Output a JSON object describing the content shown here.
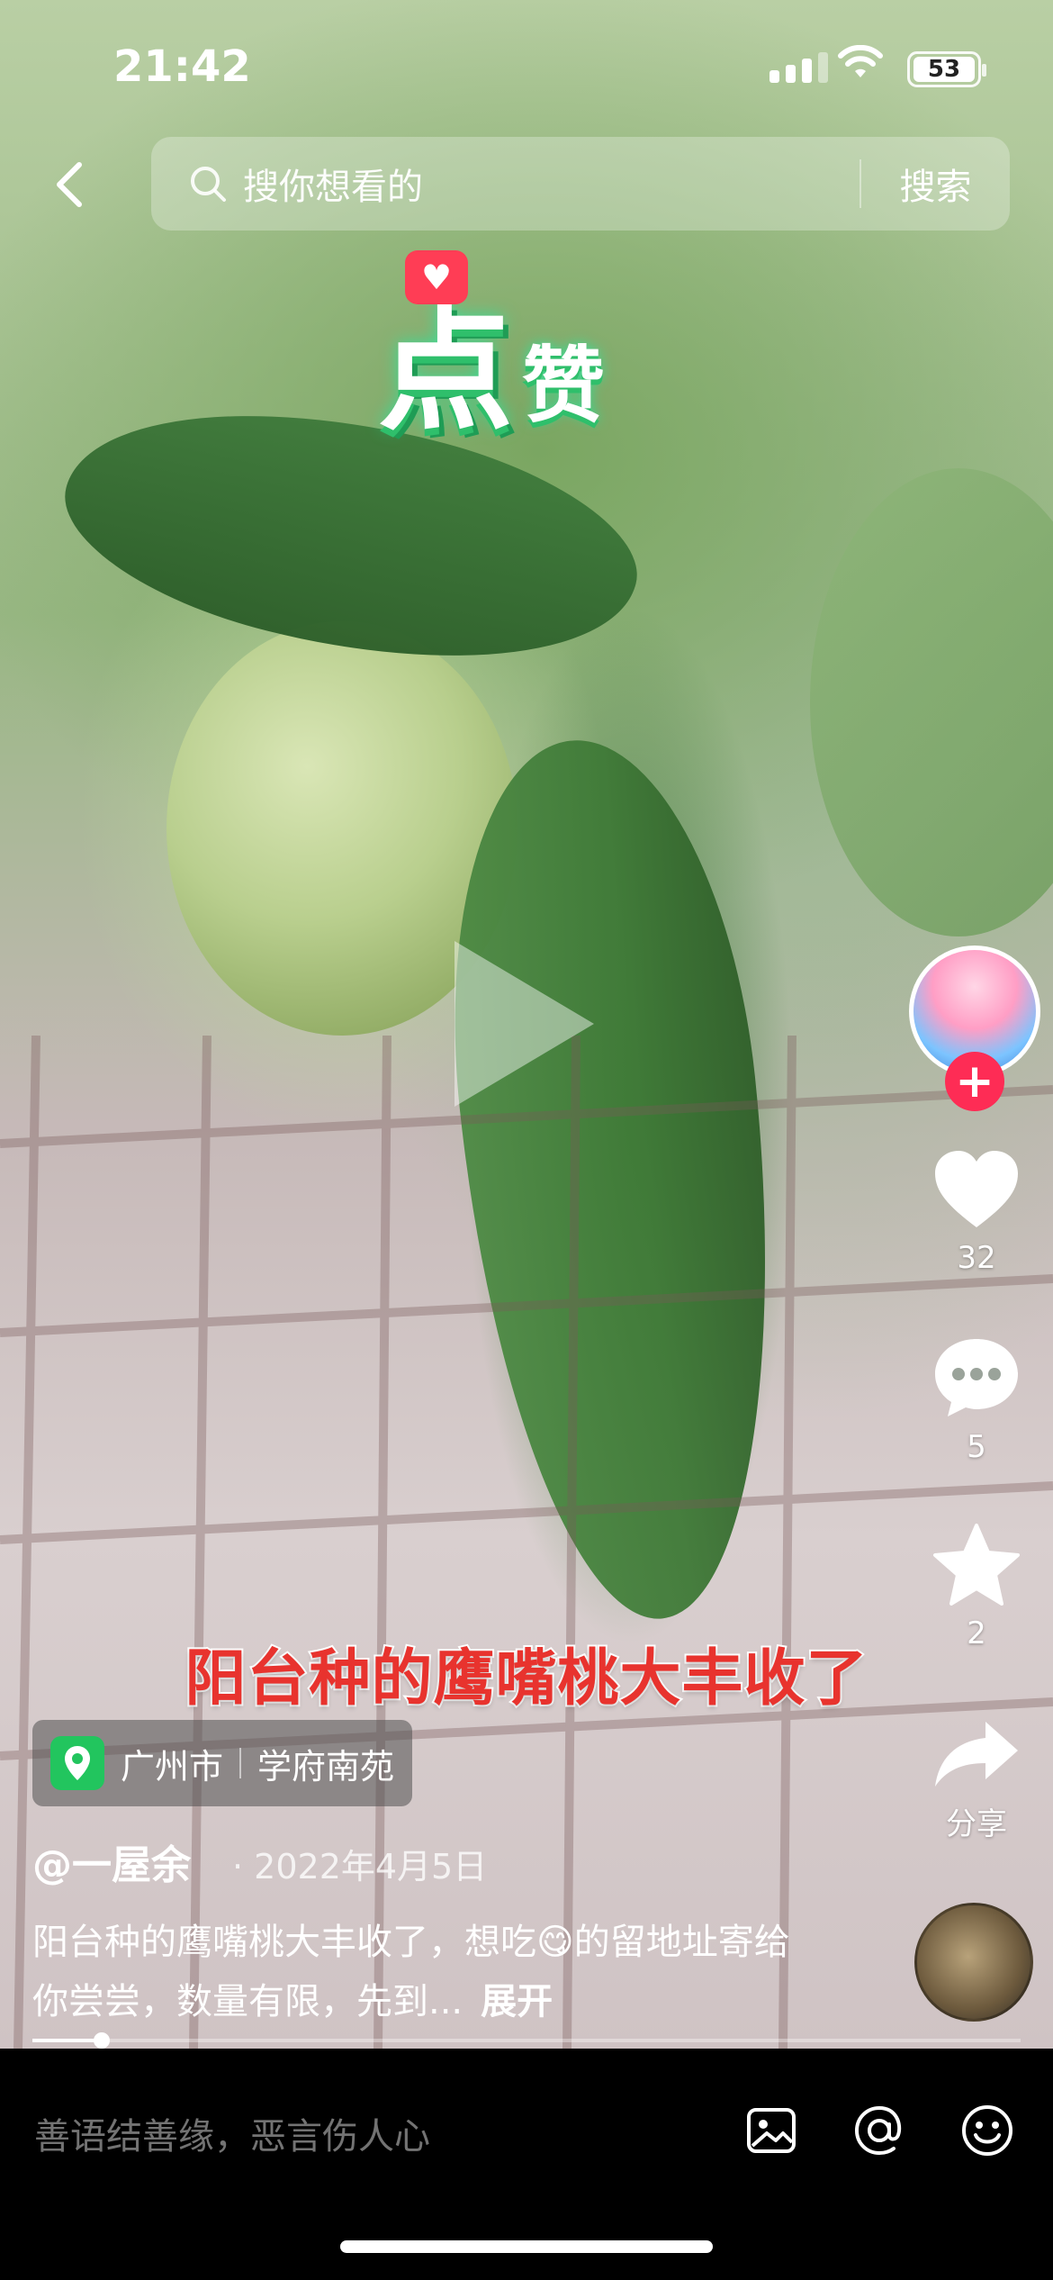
{
  "status_bar": {
    "time": "21:42",
    "battery": "53"
  },
  "search": {
    "placeholder": "搜你想看的",
    "button": "搜索"
  },
  "sticker": {
    "big": "点",
    "small": "赞"
  },
  "video": {
    "caption": "阳台种的鹰嘴桃大丰收了",
    "progress": 0.07
  },
  "actions": {
    "likes": "32",
    "comments": "5",
    "favorites": "2",
    "share": "分享"
  },
  "location": {
    "city": "广州市",
    "place": "学府南苑"
  },
  "post": {
    "author": "@一屋余",
    "date": "· 2022年4月5日",
    "description": "阳台种的鹰嘴桃大丰收了，想吃😋的留地址寄给你尝尝，数量有限，先到...",
    "expand": "展开"
  },
  "comment_bar": {
    "placeholder": "善语结善缘，恶言伤人心"
  },
  "colors": {
    "like_accent": "#fe2c55",
    "caption_red": "#e8332e",
    "location_green": "#22c55e"
  }
}
